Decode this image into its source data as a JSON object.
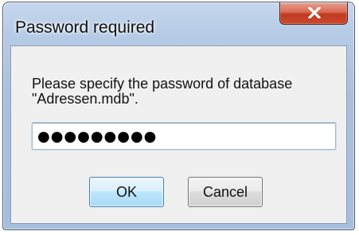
{
  "window": {
    "title": "Password required",
    "close_icon": "close-icon"
  },
  "dialog": {
    "message": "Please specify the password of database \"Adressen.mdb\".",
    "password_value": "●●●●●●●●●",
    "ok_label": "OK",
    "cancel_label": "Cancel"
  },
  "colors": {
    "title_frame": "#b7cce6",
    "close_button": "#c94a2e",
    "client_area": "#f0f0f0",
    "ok_button_border": "#3c7fb1"
  }
}
